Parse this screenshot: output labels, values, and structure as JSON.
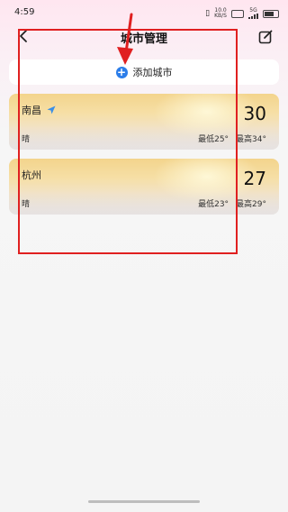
{
  "status_bar": {
    "time": "4:59",
    "network_rate": "10.0",
    "network_unit": "KB/S",
    "signal_label": "5G"
  },
  "header": {
    "title": "城市管理"
  },
  "add_city": {
    "label": "添加城市"
  },
  "cities": [
    {
      "name": "南昌",
      "located": true,
      "temp": "30",
      "condition": "晴",
      "low": "最低25°",
      "high": "最高34°"
    },
    {
      "name": "杭州",
      "located": false,
      "temp": "27",
      "condition": "晴",
      "low": "最低23°",
      "high": "最高29°"
    }
  ],
  "annotation": {
    "color": "#e02020"
  }
}
